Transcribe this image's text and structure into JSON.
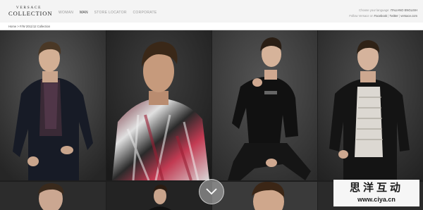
{
  "header": {
    "logo_top": "VERSACE",
    "logo_bottom": "COLLECTION",
    "nav": [
      "WOMAN",
      "MAN",
      "STORE LOCATOR",
      "CORPORATE"
    ],
    "active_nav": "MAN",
    "language": {
      "label": "Choose your language:",
      "options": [
        "ITALIANO",
        "ENGLISH"
      ]
    },
    "social": {
      "label": "Follow Versace on",
      "links": [
        "Facebook",
        "Twitter"
      ],
      "site": "versace.com"
    }
  },
  "breadcrumb": {
    "home": "Home",
    "current": "F/W 2011/12 Collection"
  },
  "gallery": {
    "scroll_icon": "chevron-down-icon"
  },
  "watermark": {
    "chinese": "思洋互动",
    "url": "www.ciya.cn"
  },
  "colors": {
    "header_bg": "#f4f4f4",
    "page_bg": "#1e1e1e",
    "scroll_button": "#bebebe"
  }
}
